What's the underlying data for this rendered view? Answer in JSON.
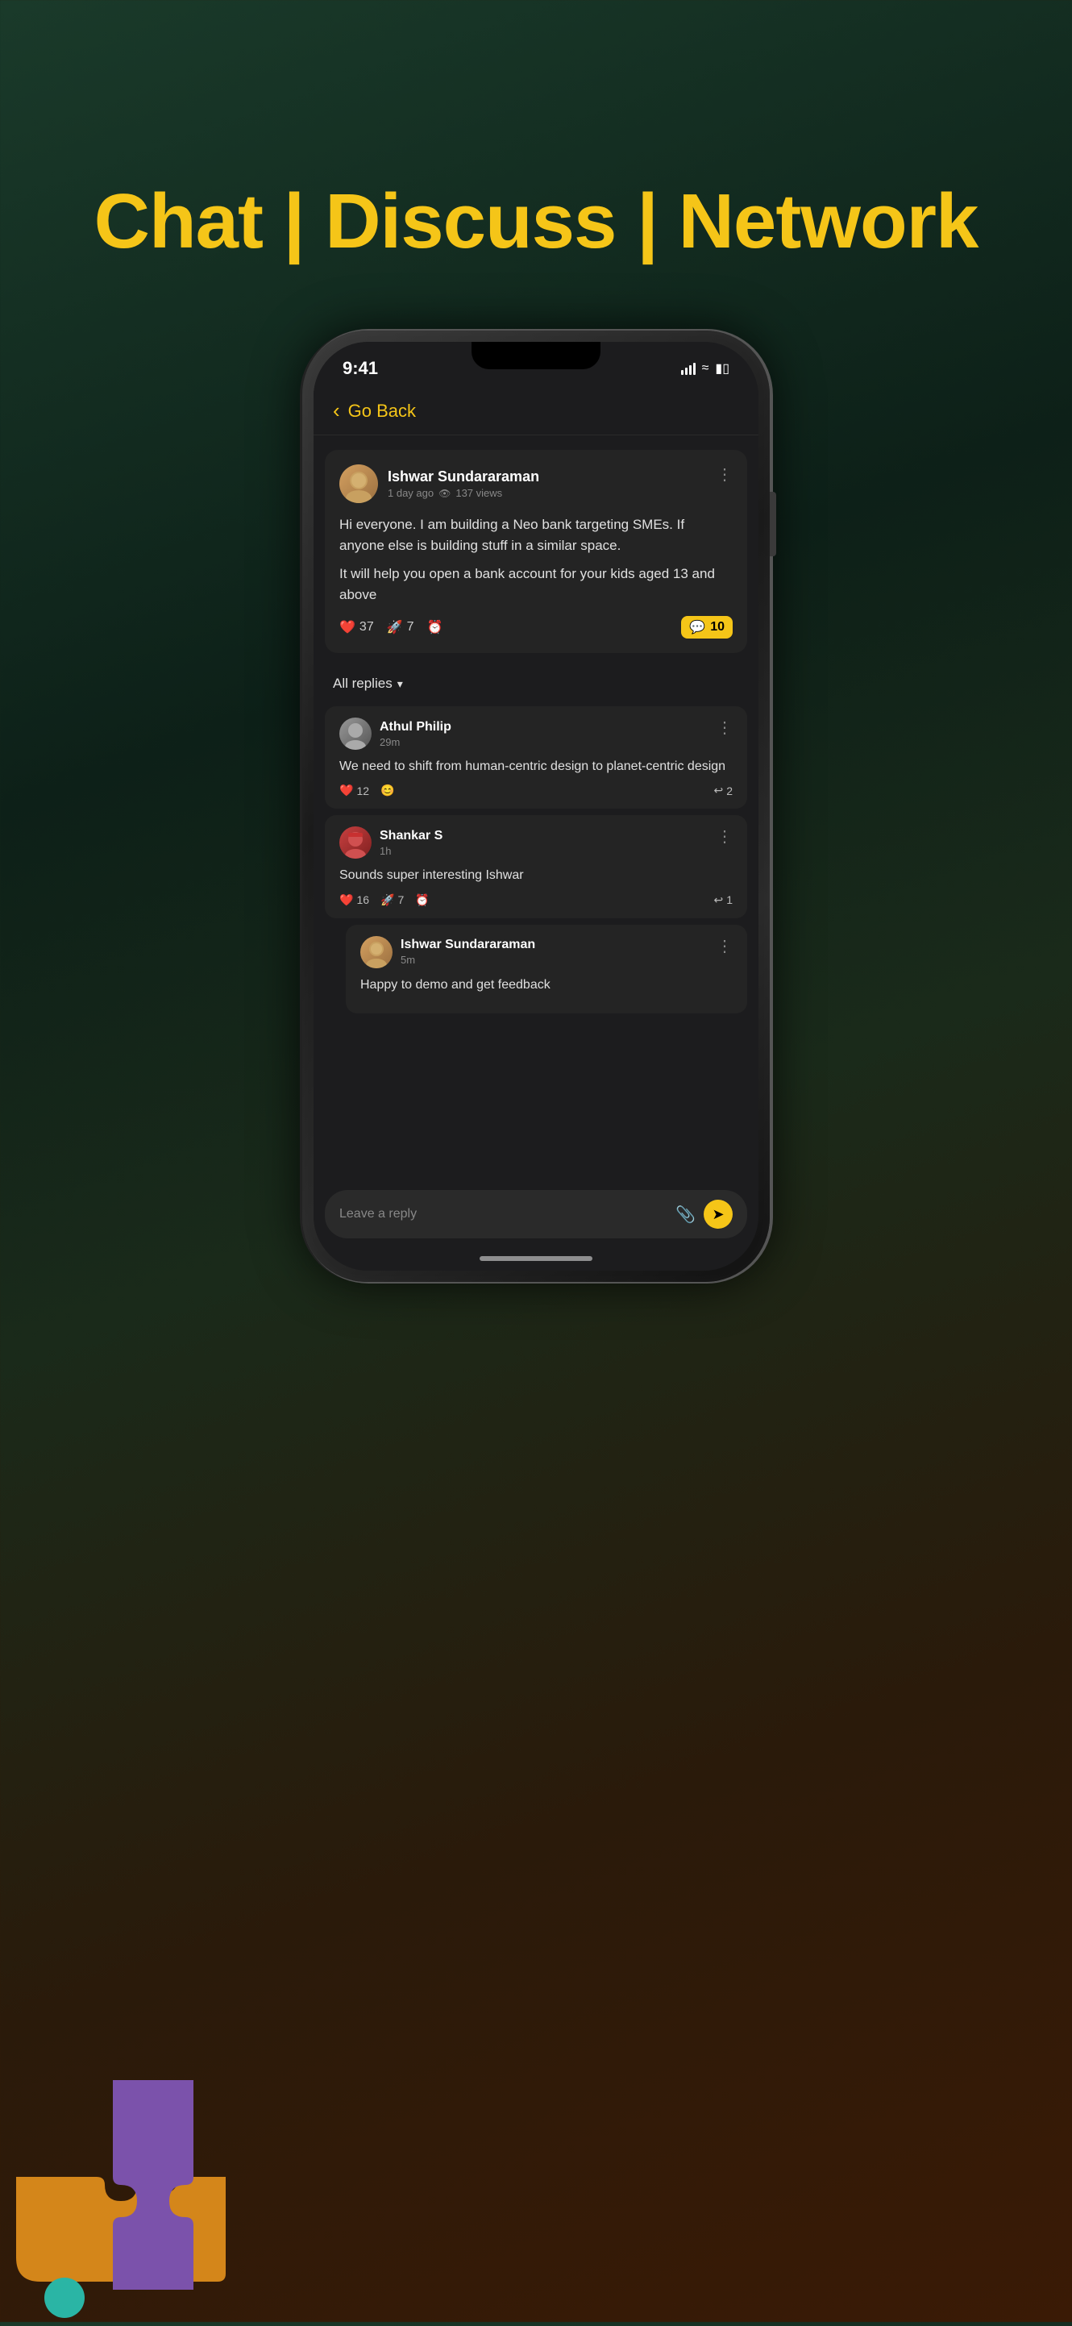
{
  "page": {
    "background": "#1a3a2a",
    "headline": "Chat | Discuss | Network"
  },
  "status_bar": {
    "time": "9:41"
  },
  "header": {
    "back_label": "Go Back"
  },
  "post": {
    "author": "Ishwar Sundararaman",
    "meta": "1 day ago",
    "views": "137 views",
    "text1": "Hi everyone. I am building a Neo bank targeting SMEs. If anyone else is building stuff in a similar space.",
    "text2": "It will help you open a bank account for your kids aged 13 and above",
    "heart_count": "37",
    "rocket_count": "7",
    "comment_count": "10"
  },
  "replies_label": "All replies",
  "replies": [
    {
      "author": "Athul Philip",
      "time": "29m",
      "text": "We need to shift from human-centric design to planet-centric design",
      "heart_count": "12",
      "reply_count": "2",
      "avatar_color": "#888"
    },
    {
      "author": "Shankar S",
      "time": "1h",
      "text": "Sounds super interesting Ishwar",
      "heart_count": "16",
      "rocket_count": "7",
      "reply_count": "1",
      "avatar_color": "#c84040"
    },
    {
      "author": "Ishwar Sundararaman",
      "time": "5m",
      "text": "Happy to demo and get feedback",
      "avatar_color": "#d4a060"
    }
  ],
  "input": {
    "placeholder": "Leave a reply"
  },
  "puzzle": {
    "orange_color": "#d4861a",
    "purple_color": "#7b52ab",
    "teal_color": "#2ab5a5"
  }
}
